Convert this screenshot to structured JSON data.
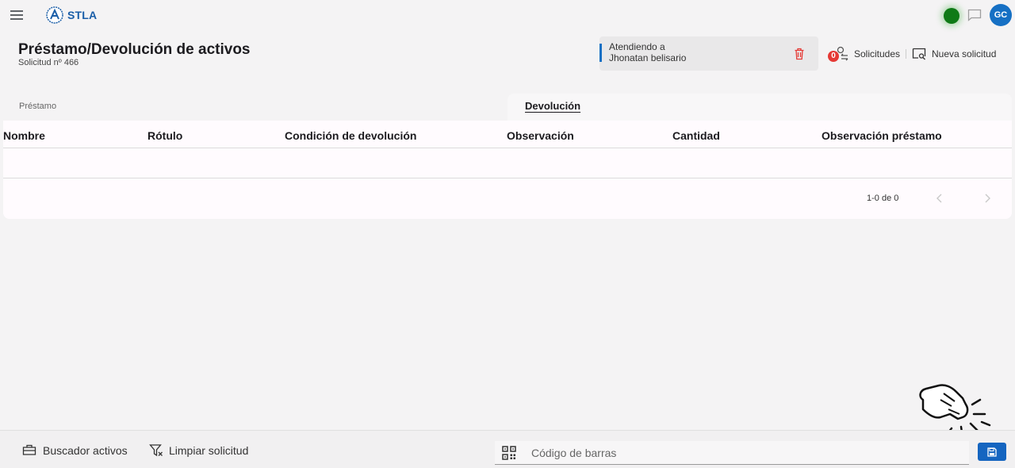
{
  "app": {
    "brand": "STLA",
    "avatar_initials": "GC",
    "status_color": "#0f7a16",
    "accent_color": "#1670c4",
    "icons": [
      "menu-icon",
      "logo-icon",
      "chat-icon",
      "trash-icon",
      "requests-icon",
      "new-request-icon",
      "briefcase-icon",
      "filter-clear-icon",
      "qr-code-icon",
      "save-icon",
      "chevron-left-icon",
      "chevron-right-icon"
    ]
  },
  "page": {
    "title": "Préstamo/Devolución de activos",
    "subtitle": "Solicitud nº 466"
  },
  "attending": {
    "label": "Atendiendo a",
    "name": "Jhonatan belisario"
  },
  "actions": {
    "requests_badge": "0",
    "requests_label": "Solicitudes",
    "new_request_label": "Nueva solicitud"
  },
  "tabs": [
    {
      "label": "Préstamo",
      "active": false
    },
    {
      "label": "Devolución",
      "active": true
    }
  ],
  "table": {
    "columns": [
      "Nombre",
      "Rótulo",
      "Condición de devolución",
      "Observación",
      "Cantidad",
      "Observación préstamo"
    ],
    "rows": [],
    "range_label": "1-0 de 0"
  },
  "bottom": {
    "search_assets_label": "Buscador activos",
    "clear_request_label": "Limpiar solicitud",
    "barcode_placeholder": "Código de barras"
  }
}
